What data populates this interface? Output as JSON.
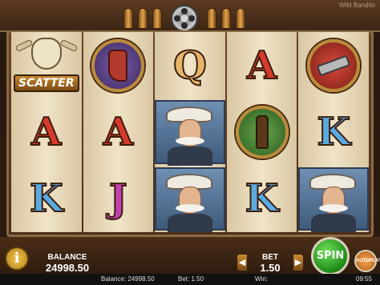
{
  "header": {
    "brand": "Wild Bandito"
  },
  "symbols": {
    "scatter_label": "SCATTER",
    "reels": [
      [
        "scatter",
        "A",
        "K"
      ],
      [
        "boot-medallion",
        "A",
        "J"
      ],
      [
        "Q",
        "sheriff",
        "sheriff"
      ],
      [
        "A",
        "whisky-medallion",
        "K"
      ],
      [
        "revolver-medallion",
        "K",
        "sheriff"
      ]
    ]
  },
  "controls": {
    "info_label": "i",
    "balance_label": "BALANCE",
    "balance_value": "24998.50",
    "bet_label": "BET",
    "bet_value": "1.50",
    "bet_decrease": "◀",
    "bet_increase": "▶",
    "spin_label": "SPIN",
    "autoplay_label": "AUTOPLAY"
  },
  "status": {
    "balance_text": "Balance: 24998.50",
    "bet_text": "Bet: 1.50",
    "win_text": "Win:",
    "time": "09:55"
  },
  "colors": {
    "frame": "#6a4427",
    "reel_bg": "#efe3c7",
    "spin_green": "#2fa82a",
    "letter_a": "#d63a2c",
    "letter_k": "#5aa9e0",
    "letter_q": "#e6b56a",
    "letter_j": "#c33fb0"
  }
}
